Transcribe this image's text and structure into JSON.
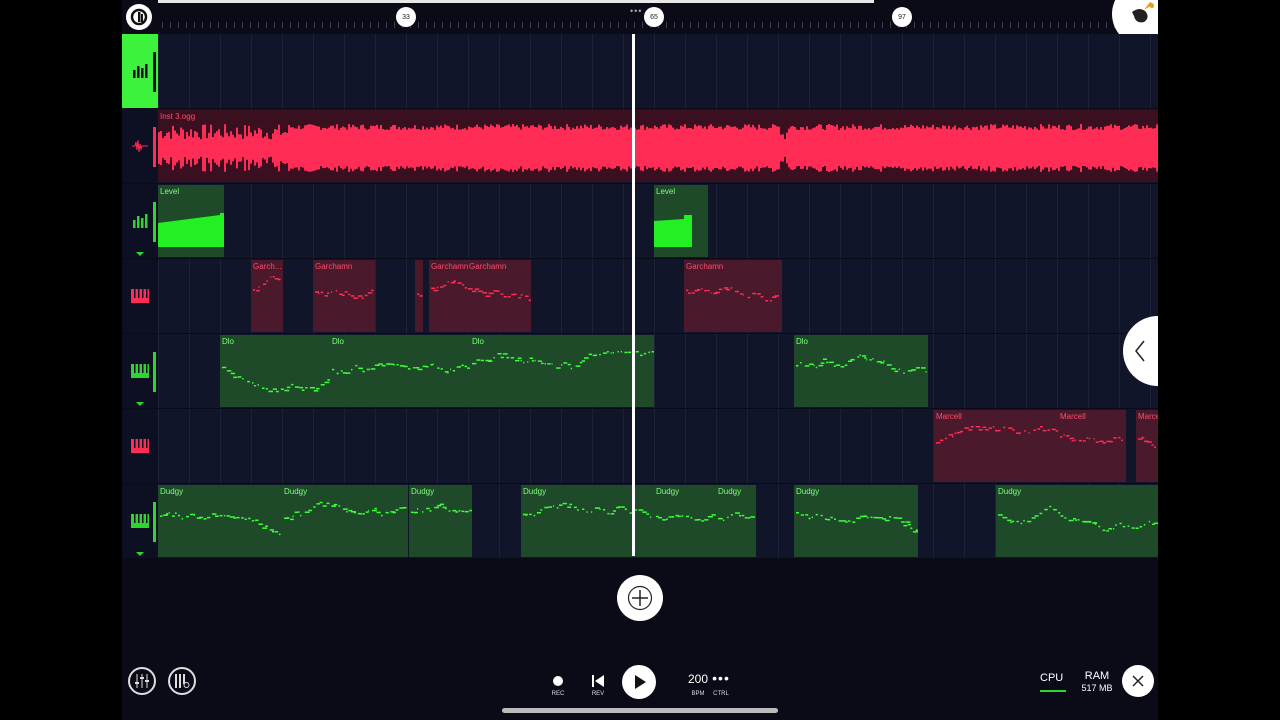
{
  "ruler": {
    "markers": [
      "33",
      "65",
      "97"
    ],
    "dots": "•••"
  },
  "tracks": {
    "audio_clip_name": "Inst 3.ogg",
    "level_clips": [
      "Level",
      "Level"
    ],
    "garchamn_clips": [
      "Garch...",
      "Garchamn",
      "Garchamn",
      "Garchamn",
      "Garchamn"
    ],
    "dlo_clips": [
      "Dlo",
      "Dlo",
      "Dlo",
      "Dlo"
    ],
    "marcell_clips": [
      "Marcell",
      "Marcell",
      "Marce"
    ],
    "dudgy_clips": [
      "Dudgy",
      "Dudgy",
      "Dudgy",
      "Dudgy",
      "Dudgy",
      "Dudgy",
      "Dudgy",
      "Dudgy"
    ]
  },
  "transport": {
    "rec_label": "REC",
    "rev_label": "REV",
    "bpm_value": "200",
    "bpm_label": "BPM",
    "ctrl_label": "CTRL",
    "more_glyph": "•••"
  },
  "status": {
    "cpu_label": "CPU",
    "ram_label": "RAM",
    "ram_value": "517 MB"
  },
  "icons": {
    "logo": "fl-logo-icon",
    "badge": "fruit-badge-icon",
    "add": "plus-icon",
    "mixer": "mixer-icon",
    "settings": "mixer-settings-icon",
    "close": "close-icon",
    "side": "chevron-left-icon"
  },
  "colors": {
    "green_accent": "#22f022",
    "red_accent": "#ff2d55",
    "background": "#0a0b17"
  }
}
